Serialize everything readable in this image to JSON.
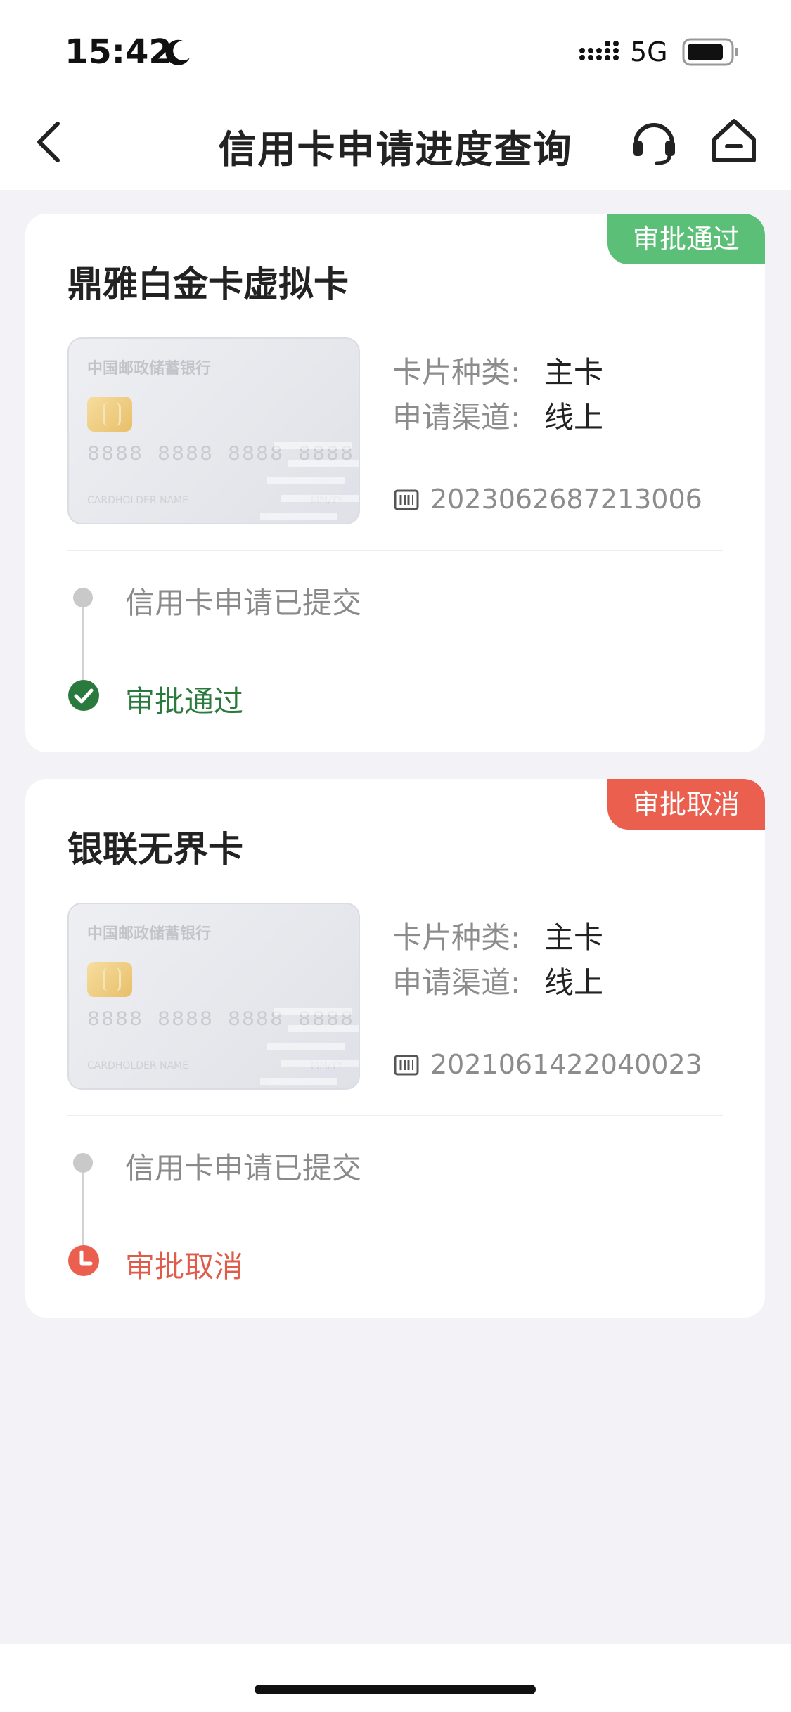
{
  "status_bar": {
    "time": "15:42",
    "network": "5G"
  },
  "nav": {
    "title": "信用卡申请进度查询",
    "icons": [
      "chevron-left-icon",
      "headset-icon",
      "home-icon"
    ]
  },
  "applications": [
    {
      "product_name": "鼎雅白金卡虚拟卡",
      "status_badge": "审批通过",
      "status_color": "#5cbf77",
      "card_face": {
        "bank_name": "中国邮政储蓄银行",
        "number": "8888 8888 8888 8888",
        "holder": "CARDHOLDER NAME",
        "expiry": "MM/YY"
      },
      "card_type_label": "卡片种类:",
      "card_type_value": "主卡",
      "channel_label": "申请渠道:",
      "channel_value": "线上",
      "application_no": "2023062687213006",
      "steps": [
        {
          "label": "信用卡申请已提交",
          "state": "done"
        },
        {
          "label": "审批通过",
          "state": "approved",
          "color": "#2b7a3d"
        }
      ]
    },
    {
      "product_name": "银联无界卡",
      "status_badge": "审批取消",
      "status_color": "#ea5f4e",
      "card_face": {
        "bank_name": "中国邮政储蓄银行",
        "number": "8888 8888 8888 8888",
        "holder": "CARDHOLDER NAME",
        "expiry": "MM/YY"
      },
      "card_type_label": "卡片种类:",
      "card_type_value": "主卡",
      "channel_label": "申请渠道:",
      "channel_value": "线上",
      "application_no": "2021061422040023",
      "steps": [
        {
          "label": "信用卡申请已提交",
          "state": "done"
        },
        {
          "label": "审批取消",
          "state": "cancelled",
          "color": "#e05b49"
        }
      ]
    }
  ]
}
